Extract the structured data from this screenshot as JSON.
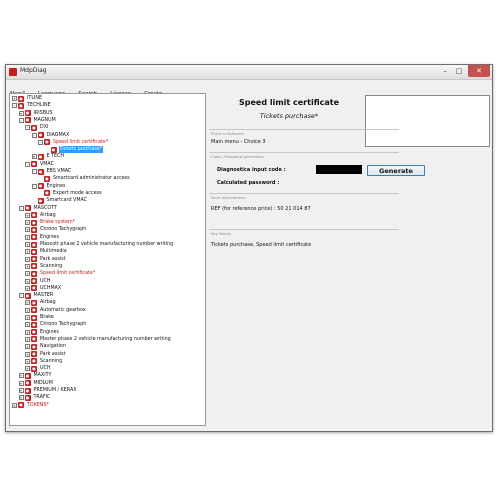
{
  "window": {
    "title": "MdpDiag",
    "min": "–",
    "max": "□",
    "close": "✕"
  },
  "menu": [
    "New?",
    "Language",
    "Search",
    "Licence",
    "Create"
  ],
  "tree": [
    {
      "depth": 0,
      "exp": "+",
      "label": "ITLINE",
      "red": false,
      "sel": false
    },
    {
      "depth": 0,
      "exp": "-",
      "label": "TECHLINE",
      "red": false,
      "sel": false
    },
    {
      "depth": 1,
      "exp": "+",
      "label": "IRISBUS",
      "red": false,
      "sel": false
    },
    {
      "depth": 1,
      "exp": "-",
      "label": "MAGNUM",
      "red": false,
      "sel": false
    },
    {
      "depth": 2,
      "exp": "-",
      "label": "DXI",
      "red": false,
      "sel": false
    },
    {
      "depth": 3,
      "exp": "-",
      "label": "DIAGMAX",
      "red": false,
      "sel": false
    },
    {
      "depth": 4,
      "exp": "-",
      "label": "Speed limit certificate*",
      "red": true,
      "sel": false
    },
    {
      "depth": 5,
      "exp": "",
      "label": "Tickets purchase*",
      "red": false,
      "sel": true
    },
    {
      "depth": 3,
      "exp": "+",
      "label": "E TECH",
      "red": false,
      "sel": false
    },
    {
      "depth": 2,
      "exp": "-",
      "label": "VMAC",
      "red": false,
      "sel": false
    },
    {
      "depth": 3,
      "exp": "-",
      "label": "EBS VMAC",
      "red": false,
      "sel": false
    },
    {
      "depth": 4,
      "exp": "",
      "label": "Smartcard administrator access",
      "red": false,
      "sel": false
    },
    {
      "depth": 3,
      "exp": "-",
      "label": "Engines",
      "red": false,
      "sel": false
    },
    {
      "depth": 4,
      "exp": "",
      "label": "Expert mode access",
      "red": false,
      "sel": false
    },
    {
      "depth": 3,
      "exp": "",
      "label": "Smartcard VMAC",
      "red": false,
      "sel": false
    },
    {
      "depth": 1,
      "exp": "-",
      "label": "MASCOTT",
      "red": false,
      "sel": false
    },
    {
      "depth": 2,
      "exp": "+",
      "label": "Airbag",
      "red": false,
      "sel": false
    },
    {
      "depth": 2,
      "exp": "+",
      "label": "Brake system*",
      "red": true,
      "sel": false
    },
    {
      "depth": 2,
      "exp": "+",
      "label": "Chrono Tachygraph",
      "red": false,
      "sel": false
    },
    {
      "depth": 2,
      "exp": "+",
      "label": "Engines",
      "red": false,
      "sel": false
    },
    {
      "depth": 2,
      "exp": "+",
      "label": "Mascott phase 2 vehicle manufacturing number writing",
      "red": false,
      "sel": false
    },
    {
      "depth": 2,
      "exp": "+",
      "label": "Multimedia",
      "red": false,
      "sel": false
    },
    {
      "depth": 2,
      "exp": "+",
      "label": "Park assist",
      "red": false,
      "sel": false
    },
    {
      "depth": 2,
      "exp": "+",
      "label": "Scanning",
      "red": false,
      "sel": false
    },
    {
      "depth": 2,
      "exp": "+",
      "label": "Speed limit certificate*",
      "red": true,
      "sel": false
    },
    {
      "depth": 2,
      "exp": "+",
      "label": "UCH",
      "red": false,
      "sel": false
    },
    {
      "depth": 2,
      "exp": "+",
      "label": "UCHMAX",
      "red": false,
      "sel": false
    },
    {
      "depth": 1,
      "exp": "-",
      "label": "MASTER",
      "red": false,
      "sel": false
    },
    {
      "depth": 2,
      "exp": "+",
      "label": "Airbag",
      "red": false,
      "sel": false
    },
    {
      "depth": 2,
      "exp": "+",
      "label": "Automatic gearbox",
      "red": false,
      "sel": false
    },
    {
      "depth": 2,
      "exp": "+",
      "label": "Brake",
      "red": false,
      "sel": false
    },
    {
      "depth": 2,
      "exp": "+",
      "label": "Chrono Tachygraph",
      "red": false,
      "sel": false
    },
    {
      "depth": 2,
      "exp": "+",
      "label": "Engines",
      "red": false,
      "sel": false
    },
    {
      "depth": 2,
      "exp": "+",
      "label": "Master phase 2 vehicle manufacturing number writing",
      "red": false,
      "sel": false
    },
    {
      "depth": 2,
      "exp": "+",
      "label": "Navigation",
      "red": false,
      "sel": false
    },
    {
      "depth": 2,
      "exp": "+",
      "label": "Park assist",
      "red": false,
      "sel": false
    },
    {
      "depth": 2,
      "exp": "+",
      "label": "Scanning",
      "red": false,
      "sel": false
    },
    {
      "depth": 2,
      "exp": "+",
      "label": "UCH",
      "red": false,
      "sel": false
    },
    {
      "depth": 1,
      "exp": "+",
      "label": "MAXITY",
      "red": false,
      "sel": false
    },
    {
      "depth": 1,
      "exp": "+",
      "label": "MIDLUM",
      "red": false,
      "sel": false
    },
    {
      "depth": 1,
      "exp": "+",
      "label": "PREMIUM / KERAX",
      "red": false,
      "sel": false
    },
    {
      "depth": 1,
      "exp": "+",
      "label": "TRAFIC",
      "red": false,
      "sel": false
    },
    {
      "depth": 0,
      "exp": "+",
      "label": "TOKENS*",
      "red": true,
      "sel": false
    }
  ],
  "detail": {
    "title": "Speed limit certificate",
    "subtitle": "Tickets purchase*",
    "place_section": "Place in Software",
    "place_text": "Main menu - Choice 3",
    "code_section": "Code / Password generation",
    "input_label": "Diagnostica input code :",
    "password_label": "Calculated password :",
    "generate_label": "Generate",
    "more_section": "More informations",
    "ref_text": "REF (for reference price) : 50 21 014 87",
    "keywords_section": "Key Words",
    "keywords_text": "Tickets purchase, Speed limit certificate"
  },
  "colors": {
    "accent_red": "#cc2020",
    "selection": "#3399ff",
    "button_border": "#3c7fb1"
  }
}
